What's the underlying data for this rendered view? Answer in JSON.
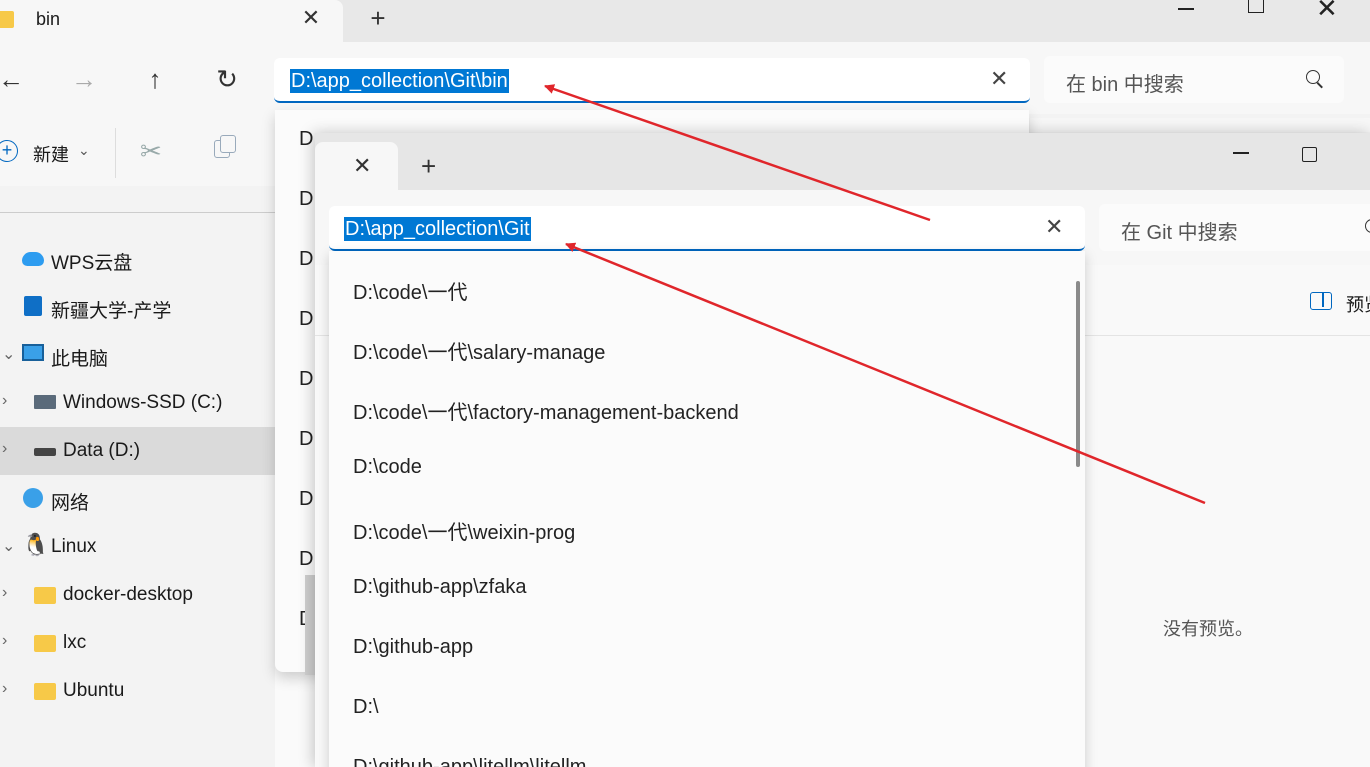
{
  "back_window": {
    "tab_title": "bin",
    "address_value": "D:\\app_collection\\Git\\bin",
    "search_placeholder": "在 bin 中搜索",
    "new_label": "新建",
    "sidebar": [
      {
        "label": "WPS云盘",
        "icon": "cloud-icon",
        "expand": false
      },
      {
        "label": "新疆大学-产学",
        "icon": "org-icon",
        "expand": false
      },
      {
        "label": "此电脑",
        "icon": "pc-icon",
        "expand": true
      },
      {
        "label": "Windows-SSD (C:)",
        "icon": "drive-icon",
        "expand": true
      },
      {
        "label": "Data (D:)",
        "icon": "drive-icon",
        "expand": true,
        "selected": true
      },
      {
        "label": "网络",
        "icon": "network-icon",
        "expand": false
      },
      {
        "label": "Linux",
        "icon": "linux-icon",
        "expand": false
      },
      {
        "label": "docker-desktop",
        "icon": "folder-icon",
        "expand": true
      },
      {
        "label": "lxc",
        "icon": "folder-icon",
        "expand": true
      },
      {
        "label": "Ubuntu",
        "icon": "folder-icon",
        "expand": true
      }
    ],
    "dropdown_partial": [
      "D:",
      "D:",
      "D:",
      "D:",
      "D:",
      "D:",
      "D:",
      "D:",
      "D:"
    ]
  },
  "front_window": {
    "address_value": "D:\\app_collection\\Git",
    "search_placeholder": "在 Git 中搜索",
    "preview_label": "预览",
    "no_preview_text": "没有预览。",
    "dropdown_items": [
      "D:\\code\\一代",
      "D:\\code\\一代\\salary-manage",
      "D:\\code\\一代\\factory-management-backend",
      "D:\\code",
      "D:\\code\\一代\\weixin-prog",
      "D:\\github-app\\zfaka",
      "D:\\github-app",
      "D:\\",
      "D:\\github-app\\litellm\\litellm"
    ]
  },
  "colors": {
    "accent": "#0067c0",
    "selection": "#0078d4",
    "annotation_arrow": "#e0262b"
  }
}
